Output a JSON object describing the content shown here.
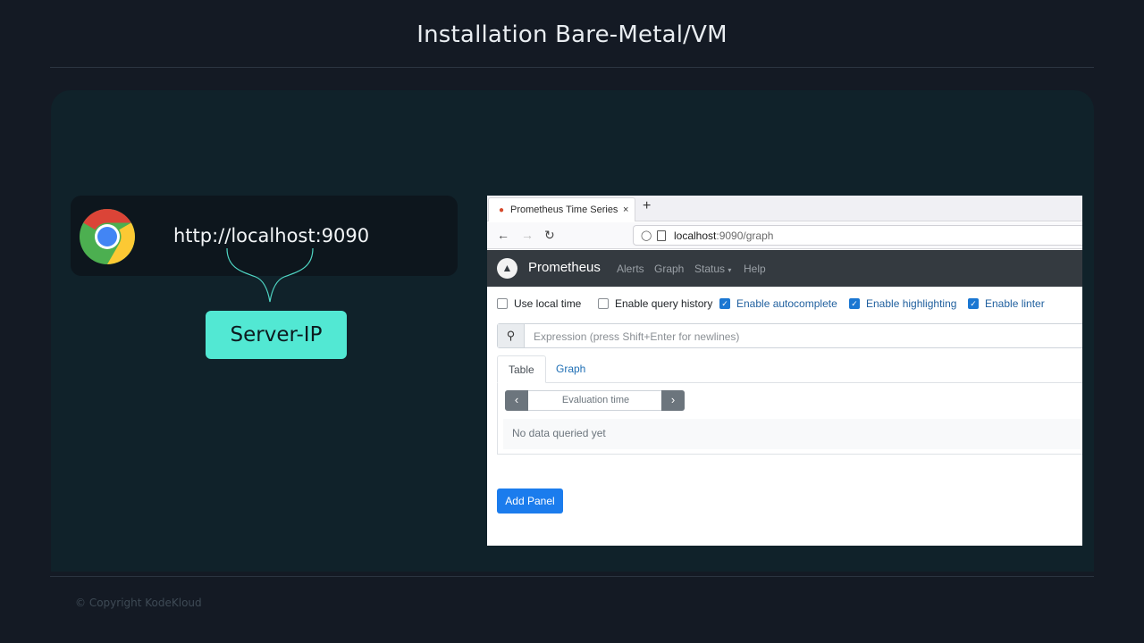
{
  "slide": {
    "title": "Installation Bare-Metal/VM",
    "copyright": "© Copyright KodeKloud"
  },
  "diagram": {
    "url": "http://localhost:9090",
    "server_label": "Server-IP",
    "browser_icon": "chrome-icon"
  },
  "browser": {
    "tab_title": "Prometheus Time Series",
    "tab_close": "×",
    "new_tab": "+",
    "url_host": "localhost",
    "url_path": ":9090/graph",
    "nav_icons": [
      "back-arrow-icon",
      "forward-arrow-icon",
      "reload-icon"
    ]
  },
  "prometheus": {
    "brand": "Prometheus",
    "nav": {
      "alerts": "Alerts",
      "graph": "Graph",
      "status": "Status",
      "help": "Help"
    },
    "options": [
      {
        "label": "Use local time",
        "checked": false
      },
      {
        "label": "Enable query history",
        "checked": false
      },
      {
        "label": "Enable autocomplete",
        "checked": true
      },
      {
        "label": "Enable highlighting",
        "checked": true
      },
      {
        "label": "Enable linter",
        "checked": true
      }
    ],
    "expression_placeholder": "Expression (press Shift+Enter for newlines)",
    "tabs": {
      "table": "Table",
      "graph": "Graph"
    },
    "evaluation_time": "Evaluation time",
    "no_data": "No data queried yet",
    "add_panel": "Add Panel"
  },
  "colors": {
    "background": "#141a24",
    "panel": "#10222a",
    "server_box": "#52e8d3",
    "prom_nav": "#343a40",
    "checkbox_on": "#1b77d2",
    "add_panel": "#1b7ced"
  }
}
